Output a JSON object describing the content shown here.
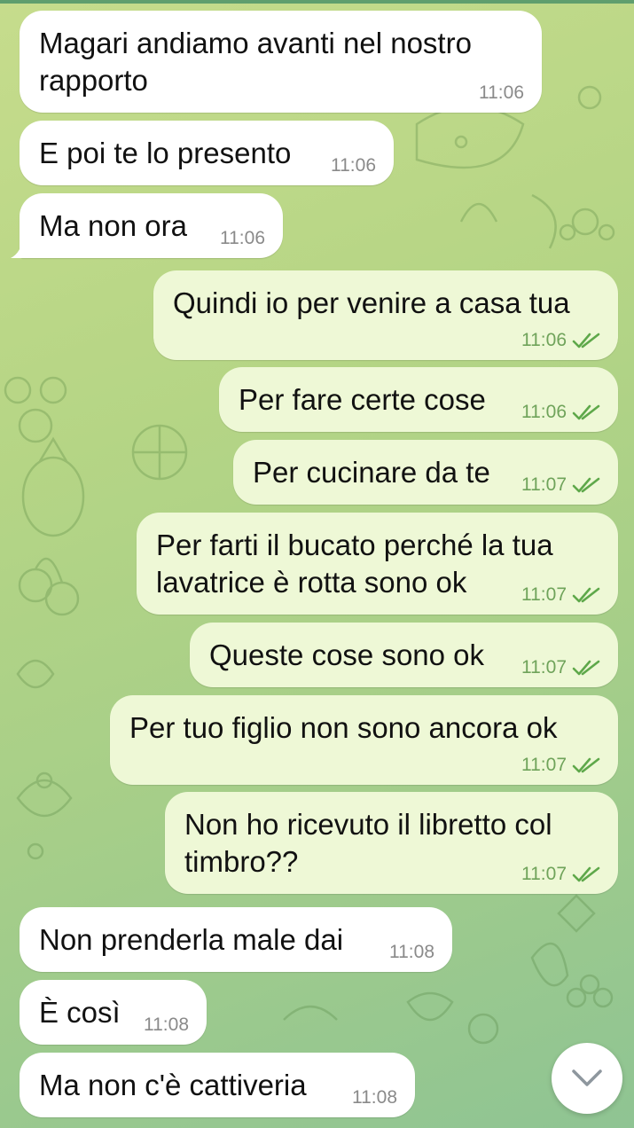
{
  "messages": [
    {
      "dir": "in",
      "text": "Magari andiamo avanti nel nostro\nrapporto",
      "time": "11:06"
    },
    {
      "dir": "in",
      "text": "E poi te lo presento",
      "time": "11:06"
    },
    {
      "dir": "in",
      "text": "Ma non ora",
      "time": "11:06"
    },
    {
      "dir": "out",
      "text": "Quindi io per venire a casa tua",
      "time": "11:06",
      "read": true
    },
    {
      "dir": "out",
      "text": "Per fare certe cose",
      "time": "11:06",
      "read": true
    },
    {
      "dir": "out",
      "text": "Per cucinare da te",
      "time": "11:07",
      "read": true
    },
    {
      "dir": "out",
      "text": "Per farti il bucato perché la tua\nlavatrice è rotta sono ok",
      "time": "11:07",
      "read": true
    },
    {
      "dir": "out",
      "text": "Queste cose sono ok",
      "time": "11:07",
      "read": true
    },
    {
      "dir": "out",
      "text": "Per tuo figlio non sono ancora ok",
      "time": "11:07",
      "read": true
    },
    {
      "dir": "out",
      "text": "Non ho ricevuto il libretto col\ntimbro??",
      "time": "11:07",
      "read": true
    },
    {
      "dir": "in",
      "text": "Non prenderla male dai",
      "time": "11:08"
    },
    {
      "dir": "in",
      "text": "È così",
      "time": "11:08"
    },
    {
      "dir": "in",
      "text": "Ma non c'è cattiveria",
      "time": "11:08"
    }
  ],
  "scroll_button": {
    "icon": "chevron-down-icon"
  },
  "colors": {
    "incoming": "#ffffff",
    "outgoing": "#eef8d6",
    "check": "#5ea84a",
    "wallpaper": "#b5d585"
  }
}
